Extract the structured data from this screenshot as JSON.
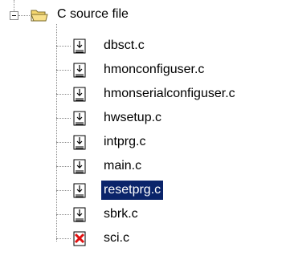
{
  "tree": {
    "root": {
      "label": "C source file",
      "icon": "open-folder-icon",
      "expanded": true
    },
    "items": [
      {
        "label": "dbsct.c",
        "icon": "text-file-icon"
      },
      {
        "label": "hmonconfiguser.c",
        "icon": "text-file-icon"
      },
      {
        "label": "hmonserialconfiguser.c",
        "icon": "text-file-icon"
      },
      {
        "label": "hwsetup.c",
        "icon": "text-file-icon"
      },
      {
        "label": "intprg.c",
        "icon": "text-file-icon"
      },
      {
        "label": "main.c",
        "icon": "text-file-icon"
      },
      {
        "label": "resetprg.c",
        "icon": "text-file-icon",
        "selected": true
      },
      {
        "label": "sbrk.c",
        "icon": "text-file-icon"
      },
      {
        "label": "sci.c",
        "icon": "excluded-file-icon"
      }
    ]
  },
  "colors": {
    "selection_bg": "#0a246a",
    "selection_fg": "#ffffff",
    "tree_lines": "#8a8a8a",
    "folder_yellow": "#f5d76e",
    "excluded_red": "#e01010"
  }
}
